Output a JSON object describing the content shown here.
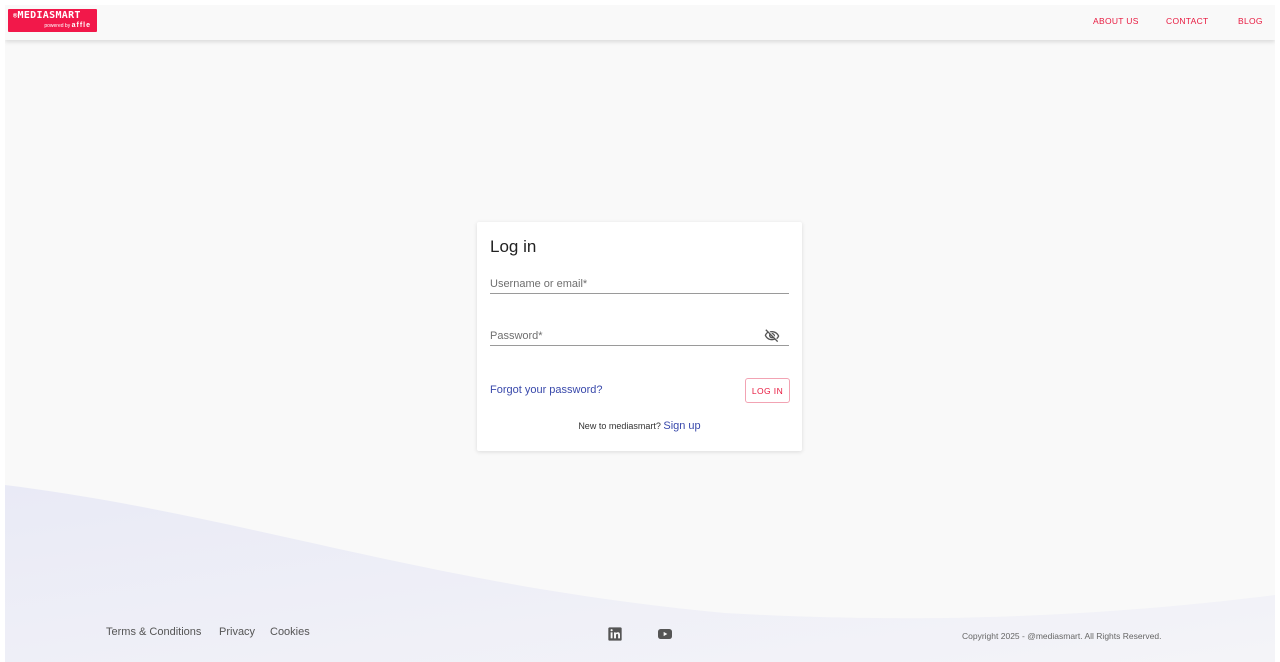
{
  "brand": {
    "logo_text": "MEDIASMART",
    "logo_sub_prefix": "powered by",
    "logo_sub_brand": "affle",
    "accent_color": "#f2184a"
  },
  "nav": {
    "about": "ABOUT US",
    "contact": "CONTACT",
    "blog": "BLOG"
  },
  "login": {
    "title": "Log in",
    "username_label": "Username or email",
    "password_label": "Password",
    "required_mark": "*",
    "password_icon": "eye-off-icon",
    "forgot": "Forgot your password?",
    "submit": "LOG IN",
    "signup_prompt": "New to mediasmart?",
    "signup": "Sign up"
  },
  "footer": {
    "terms": "Terms & Conditions",
    "privacy": "Privacy",
    "cookies": "Cookies",
    "social_icons": [
      "linkedin-icon",
      "youtube-icon"
    ],
    "copyright": "Copyright 2025 - @mediasmart. All Rights Reserved."
  }
}
